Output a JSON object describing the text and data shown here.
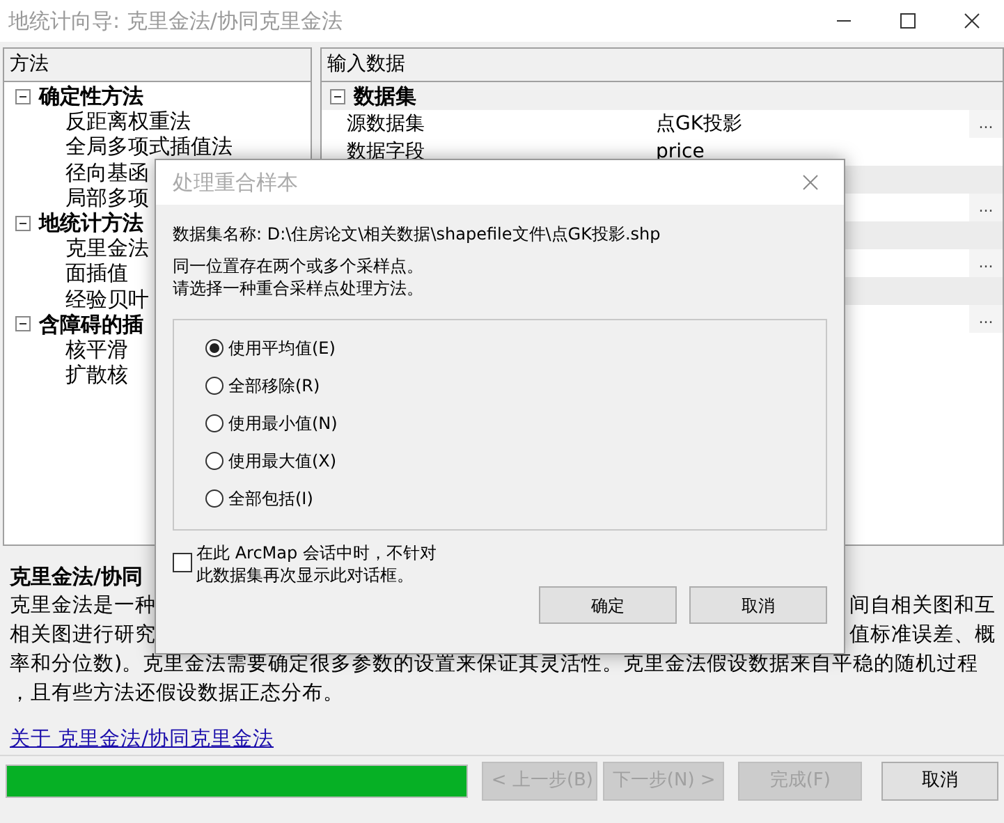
{
  "window": {
    "title": "地统计向导: 克里金法/协同克里金法"
  },
  "method_panel": {
    "header": "方法",
    "groups": [
      {
        "label": "确定性方法",
        "expanded": true,
        "children": [
          {
            "label": "反距离权重法"
          },
          {
            "label": "全局多项式插值法"
          },
          {
            "label": "径向基函"
          },
          {
            "label": "局部多项"
          }
        ]
      },
      {
        "label": "地统计方法",
        "expanded": true,
        "children": [
          {
            "label": "克里金法"
          },
          {
            "label": "面插值"
          },
          {
            "label": "经验贝叶"
          }
        ]
      },
      {
        "label": "含障碍的插",
        "expanded": true,
        "children": [
          {
            "label": "核平滑"
          },
          {
            "label": "扩散核"
          }
        ]
      }
    ]
  },
  "input_panel": {
    "header": "输入数据",
    "section": {
      "label": "数据集",
      "expanded": true
    },
    "rows": [
      {
        "kind": "property",
        "name": "源数据集",
        "value": "点GK投影",
        "button": "..."
      },
      {
        "kind": "property",
        "name": "数据字段",
        "value": "price"
      },
      {
        "kind": "band"
      },
      {
        "kind": "property",
        "button": "..."
      },
      {
        "kind": "band"
      },
      {
        "kind": "property",
        "button": "..."
      },
      {
        "kind": "band"
      },
      {
        "kind": "property",
        "button": "..."
      }
    ]
  },
  "description": {
    "title": "克里金法/协同",
    "lines": [
      {
        "left": "克里金法是一种",
        "right": "间自相关图和互"
      },
      {
        "left": "相关图进行研究",
        "right": "值标准误差、概"
      },
      {
        "full": "率和分位数)。克里金法需要确定很多参数的设置来保证其灵活性。克里金法假设数据来自平稳的随机过程"
      },
      {
        "full": "，且有些方法还假设数据正态分布。"
      }
    ],
    "link": "关于 克里金法/协同克里金法"
  },
  "footer": {
    "progress": {
      "level": 1
    },
    "buttons": [
      {
        "label": "< 上一步(B)",
        "disabled": true
      },
      {
        "label": "下一步(N) >",
        "disabled": true
      },
      {
        "label": "完成(F)",
        "disabled": true
      },
      {
        "label": "取消",
        "disabled": false
      }
    ]
  },
  "dialog": {
    "title": "处理重合样本",
    "dataset": "数据集名称: D:\\住房论文\\相关数据\\shapefile文件\\点GK投影.shp",
    "message_lines": [
      "同一位置存在两个或多个采样点。",
      "请选择一种重合采样点处理方法。"
    ],
    "options": [
      {
        "label": "使用平均值(E)",
        "selected": true
      },
      {
        "label": "全部移除(R)",
        "selected": false
      },
      {
        "label": "使用最小值(N)",
        "selected": false
      },
      {
        "label": "使用最大值(X)",
        "selected": false
      },
      {
        "label": "全部包括(I)",
        "selected": false
      }
    ],
    "dont_show": {
      "lines": [
        "在此 ArcMap 会话中时，不针对",
        "此数据集再次显示此对话框。"
      ],
      "checked": false
    },
    "buttons": [
      "确定",
      "取消"
    ]
  }
}
